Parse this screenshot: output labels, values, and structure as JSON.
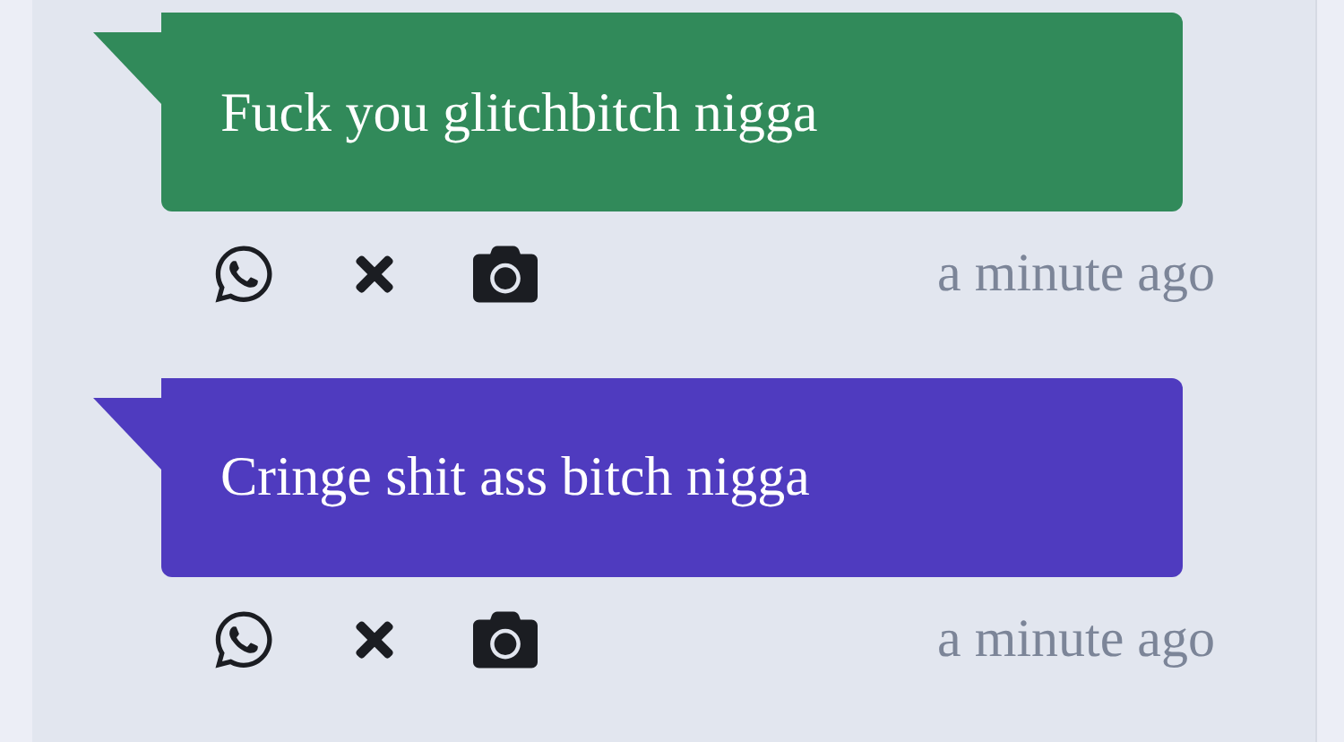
{
  "messages": [
    {
      "text": "Fuck you glitchbitch nigga",
      "color": "#318a5a",
      "time": "a minute ago"
    },
    {
      "text": "Cringe shit ass bitch nigga",
      "color": "#4f3bbf",
      "time": "a minute ago"
    }
  ]
}
